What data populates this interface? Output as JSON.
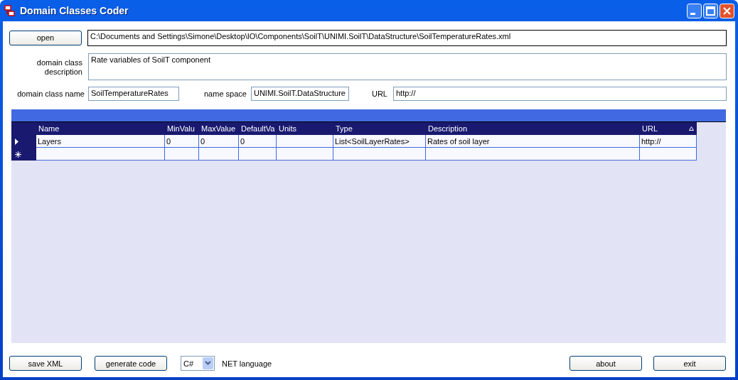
{
  "window": {
    "title": "Domain Classes Coder"
  },
  "file": {
    "button": "open",
    "path": "C:\\Documents and Settings\\Simone\\Desktop\\IO\\Components\\SoilT\\UNIMI.SoilT\\DataStructure\\SoilTemperatureRates.xml"
  },
  "description": {
    "label": "domain class description",
    "value": "Rate variables of SoilT component"
  },
  "class_name": {
    "label": "domain class name",
    "value": "SoilTemperatureRates"
  },
  "name_space": {
    "label": "name space",
    "value": "UNIMI.SoilT.DataStructure"
  },
  "url": {
    "label": "URL",
    "value": "http://"
  },
  "table": {
    "columns": [
      {
        "label": "Name",
        "sorted": false
      },
      {
        "label": "MinValu",
        "sorted": false
      },
      {
        "label": "MaxValue",
        "sorted": false
      },
      {
        "label": "DefaultVa",
        "sorted": false
      },
      {
        "label": "Units",
        "sorted": false
      },
      {
        "label": "Type",
        "sorted": false
      },
      {
        "label": "Description",
        "sorted": false
      },
      {
        "label": "URL",
        "sorted": true
      }
    ],
    "rows": [
      {
        "kind": "current",
        "cells": [
          "Layers",
          "0",
          "0",
          "0",
          "",
          "List<SoilLayerRates>",
          "Rates of soil layer",
          "http://"
        ]
      },
      {
        "kind": "new",
        "cells": [
          "",
          "",
          "",
          "",
          "",
          "",
          "",
          ""
        ]
      }
    ]
  },
  "buttons": {
    "save": "save XML",
    "generate": "generate code",
    "about": "about",
    "exit": "exit"
  },
  "language": {
    "value": "C#",
    "label": "NET language"
  }
}
